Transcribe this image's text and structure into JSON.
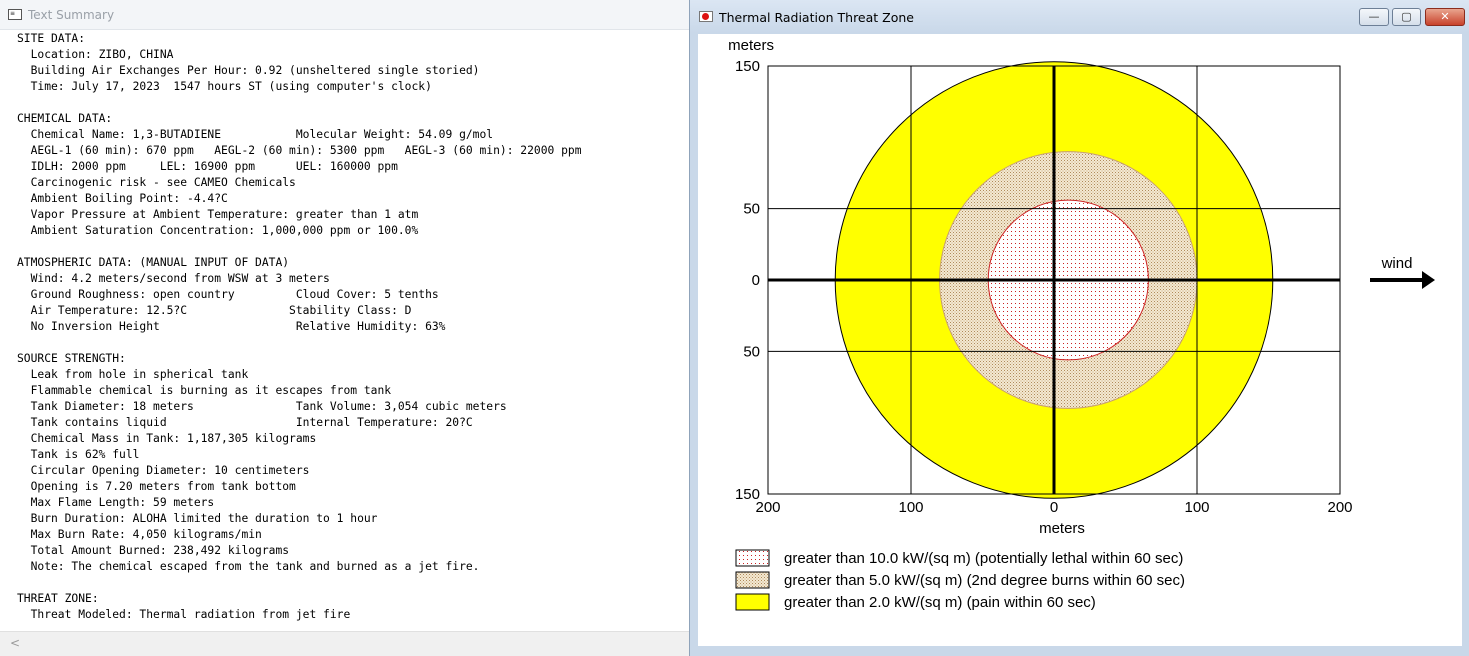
{
  "summary_window": {
    "title": "Text Summary",
    "lines": [
      "SITE DATA:",
      "  Location: ZIBO, CHINA",
      "  Building Air Exchanges Per Hour: 0.92 (unsheltered single storied)",
      "  Time: July 17, 2023  1547 hours ST (using computer's clock)",
      "",
      "CHEMICAL DATA:",
      "  Chemical Name: 1,3-BUTADIENE           Molecular Weight: 54.09 g/mol",
      "  AEGL-1 (60 min): 670 ppm   AEGL-2 (60 min): 5300 ppm   AEGL-3 (60 min): 22000 ppm",
      "  IDLH: 2000 ppm     LEL: 16900 ppm      UEL: 160000 ppm",
      "  Carcinogenic risk - see CAMEO Chemicals",
      "  Ambient Boiling Point: -4.4?C",
      "  Vapor Pressure at Ambient Temperature: greater than 1 atm",
      "  Ambient Saturation Concentration: 1,000,000 ppm or 100.0%",
      "",
      "ATMOSPHERIC DATA: (MANUAL INPUT OF DATA)",
      "  Wind: 4.2 meters/second from WSW at 3 meters",
      "  Ground Roughness: open country         Cloud Cover: 5 tenths",
      "  Air Temperature: 12.5?C               Stability Class: D",
      "  No Inversion Height                    Relative Humidity: 63%",
      "",
      "SOURCE STRENGTH:",
      "  Leak from hole in spherical tank",
      "  Flammable chemical is burning as it escapes from tank",
      "  Tank Diameter: 18 meters               Tank Volume: 3,054 cubic meters",
      "  Tank contains liquid                   Internal Temperature: 20?C",
      "  Chemical Mass in Tank: 1,187,305 kilograms",
      "  Tank is 62% full",
      "  Circular Opening Diameter: 10 centimeters",
      "  Opening is 7.20 meters from tank bottom",
      "  Max Flame Length: 59 meters",
      "  Burn Duration: ALOHA limited the duration to 1 hour",
      "  Max Burn Rate: 4,050 kilograms/min",
      "  Total Amount Burned: 238,492 kilograms",
      "  Note: The chemical escaped from the tank and burned as a jet fire.",
      "",
      "THREAT ZONE:",
      "  Threat Modeled: Thermal radiation from jet fire"
    ],
    "scroll_left": "<"
  },
  "threat_window": {
    "title": "Thermal Radiation Threat Zone",
    "controls": {
      "minimize": "—",
      "maximize": "▢",
      "close": "✕"
    },
    "wind_label": "wind"
  },
  "chart_data": {
    "type": "threat-zone-map",
    "y_unit_label": "meters",
    "xlabel": "meters",
    "x_ticks": [
      "200",
      "100",
      "0",
      "100",
      "200"
    ],
    "x_tick_values": [
      -200,
      -100,
      0,
      100,
      200
    ],
    "y_ticks": [
      "150",
      "50",
      "0",
      "50",
      "150"
    ],
    "y_tick_values": [
      150,
      50,
      0,
      -50,
      -150
    ],
    "xlim": [
      -200,
      200
    ],
    "ylim": [
      -150,
      150
    ],
    "grid": true,
    "wind_direction": "east",
    "zones": [
      {
        "label": "greater than 2.0 kW/(sq m) (pain within 60 sec)",
        "center": [
          0,
          0
        ],
        "radius": 153,
        "color": "#ffff00",
        "pattern": "solid"
      },
      {
        "label": "greater than 5.0 kW/(sq m) (2nd degree burns within 60 sec)",
        "center": [
          10,
          0
        ],
        "radius": 90,
        "color": "#c8a070",
        "pattern": "stipple"
      },
      {
        "label": "greater than 10.0 kW/(sq m) (potentially lethal within 60 sec)",
        "center": [
          10,
          0
        ],
        "radius": 56,
        "color": "#cc2222",
        "pattern": "dots"
      }
    ],
    "legend": [
      {
        "label": "greater than 10.0 kW/(sq m) (potentially lethal within 60 sec)",
        "pattern": "dots"
      },
      {
        "label": "greater than 5.0 kW/(sq m) (2nd degree burns within 60 sec)",
        "pattern": "stipple"
      },
      {
        "label": "greater than 2.0 kW/(sq m) (pain within 60 sec)",
        "pattern": "solid"
      }
    ]
  }
}
